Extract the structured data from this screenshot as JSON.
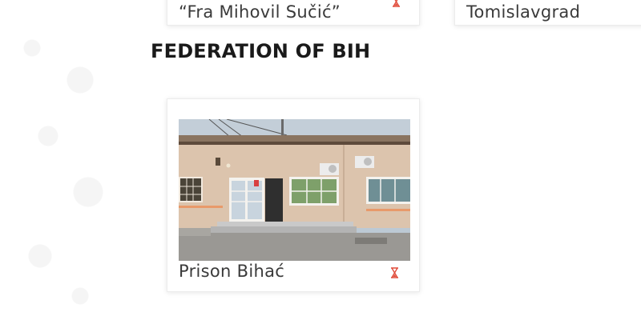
{
  "cards_top": [
    {
      "title": "“Fra Mihovil Sučić”",
      "icon": "hourglass-icon"
    },
    {
      "title": "Tomislavgrad"
    }
  ],
  "section": {
    "title": "FEDERATION OF BIH"
  },
  "cards": [
    {
      "title": "Prison Bihać",
      "icon": "hourglass-icon",
      "icon_color": "#e04b3a"
    }
  ],
  "colors": {
    "accent": "#e04b3a",
    "heading": "#1a1a1a",
    "text": "#3a3a3a"
  }
}
